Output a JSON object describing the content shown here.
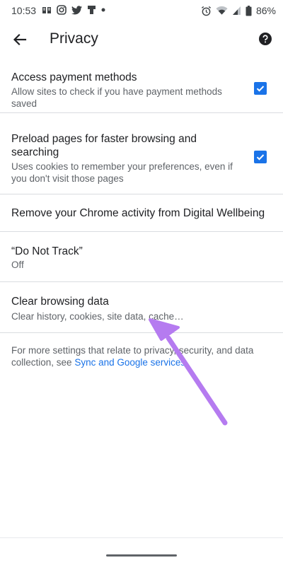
{
  "status_bar": {
    "time": "10:53",
    "battery": "86%",
    "left_icons": [
      "notification-app-icon",
      "instagram-icon",
      "twitter-icon",
      "notification-app-icon-2",
      "dot-icon"
    ],
    "right_icons": [
      "alarm-icon",
      "wifi-icon",
      "signal-icon",
      "battery-icon"
    ]
  },
  "app_bar": {
    "title": "Privacy",
    "back_icon": "arrow-back-icon",
    "help_icon": "help-icon"
  },
  "settings": [
    {
      "title": "Access payment methods",
      "summary": "Allow sites to check if you have payment methods saved",
      "checked": true
    },
    {
      "title": "Preload pages for faster browsing and searching",
      "summary": "Uses cookies to remember your preferences, even if you don't visit those pages",
      "checked": true
    },
    {
      "title": "Remove your Chrome activity from Digital Wellbeing"
    },
    {
      "title": "“Do Not Track”",
      "summary": "Off"
    },
    {
      "title": "Clear browsing data",
      "summary": "Clear history, cookies, site data, cache…"
    }
  ],
  "footer": {
    "text_before": "For more settings that relate to privacy, security, and data collection, see ",
    "link": "Sync and Google services"
  },
  "colors": {
    "accent": "#1a73e8",
    "annotation_arrow": "#b57bf0"
  }
}
